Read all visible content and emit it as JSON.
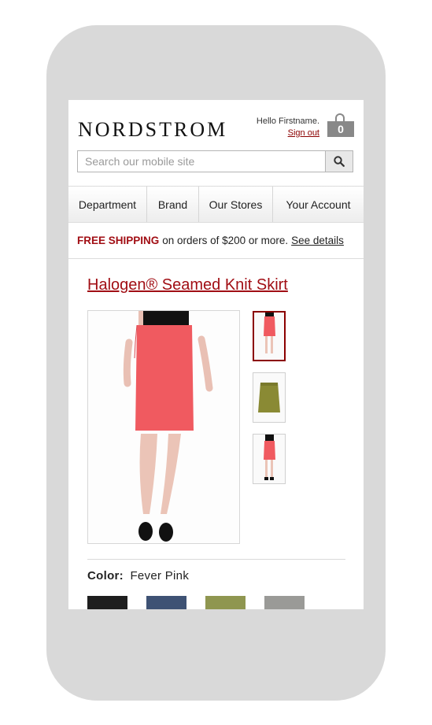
{
  "brand": {
    "logo": "NORDSTROM"
  },
  "account": {
    "greeting": "Hello Firstname.",
    "sign_out": "Sign out"
  },
  "cart": {
    "count": "0",
    "icon": "shopping-bag-icon"
  },
  "search": {
    "placeholder": "Search our mobile site",
    "icon": "search-icon"
  },
  "nav": {
    "items": [
      "Department",
      "Brand",
      "Our Stores",
      "Your Account"
    ]
  },
  "promo": {
    "highlight": "FREE SHIPPING",
    "text": "on orders of $200 or more.",
    "link": "See details"
  },
  "product": {
    "title": "Halogen® Seamed Knit Skirt",
    "color_label": "Color:",
    "color_value": "Fever Pink",
    "selected_thumbnail": 0,
    "swatches": [
      "#1e1e1e",
      "#3e5274",
      "#8f9650",
      "#9a9a97"
    ]
  },
  "colors": {
    "accent": "#a10e14",
    "skirt_pink": "#f05a60",
    "skirt_olive": "#8a8a34"
  }
}
